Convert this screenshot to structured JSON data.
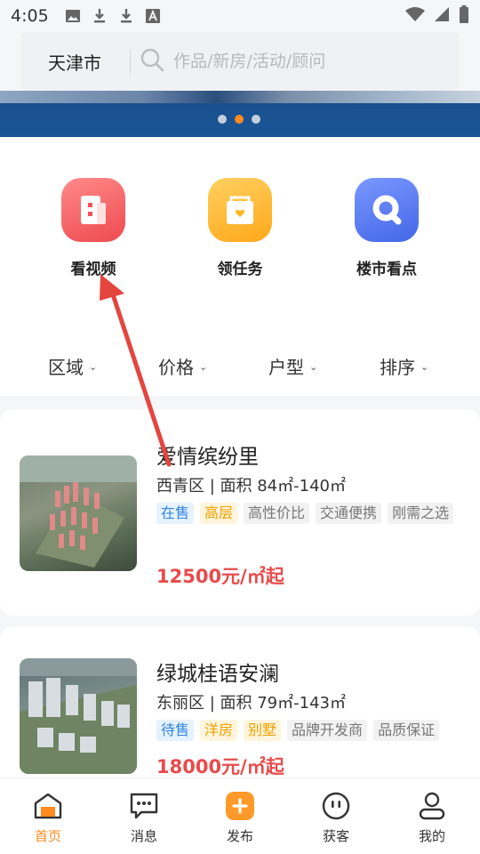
{
  "status_bar": {
    "time": "4:05"
  },
  "search": {
    "city": "天津市",
    "placeholder": "作品/新房/活动/顾问"
  },
  "banner": {
    "dots": 3,
    "active_dot": 1
  },
  "quick_actions": [
    {
      "label": "看视频",
      "icon": "video-icon",
      "color": "#f2595c"
    },
    {
      "label": "领任务",
      "icon": "task-icon",
      "color": "#ffb51f"
    },
    {
      "label": "楼市看点",
      "icon": "search-icon",
      "color": "#4c73f0"
    }
  ],
  "filters": [
    {
      "label": "区域"
    },
    {
      "label": "价格"
    },
    {
      "label": "户型"
    },
    {
      "label": "排序"
    }
  ],
  "listings": [
    {
      "title": "爱情缤纷里",
      "meta": "西青区 | 面积 84㎡-140㎡",
      "tags": [
        {
          "text": "在售",
          "style": "blue"
        },
        {
          "text": "高层",
          "style": "yellow"
        },
        {
          "text": "高性价比",
          "style": "gray"
        },
        {
          "text": "交通便携",
          "style": "gray"
        },
        {
          "text": "刚需之选",
          "style": "gray"
        }
      ],
      "price": "12500元/㎡起"
    },
    {
      "title": "绿城桂语安澜",
      "meta": "东丽区 | 面积 79㎡-143㎡",
      "tags": [
        {
          "text": "待售",
          "style": "blue"
        },
        {
          "text": "洋房",
          "style": "yellow"
        },
        {
          "text": "别墅",
          "style": "yellow"
        },
        {
          "text": "品牌开发商",
          "style": "gray"
        },
        {
          "text": "品质保证",
          "style": "gray"
        }
      ],
      "price": "18000元/㎡起"
    }
  ],
  "bottom_nav": [
    {
      "label": "首页",
      "icon": "home-icon",
      "active": true
    },
    {
      "label": "消息",
      "icon": "message-icon",
      "active": false
    },
    {
      "label": "发布",
      "icon": "publish-icon",
      "active": false
    },
    {
      "label": "获客",
      "icon": "customer-icon",
      "active": false
    },
    {
      "label": "我的",
      "icon": "profile-icon",
      "active": false
    }
  ],
  "colors": {
    "accent": "#ff8a1f",
    "price": "#e84b4b",
    "annotation_arrow": "#e5453f"
  }
}
